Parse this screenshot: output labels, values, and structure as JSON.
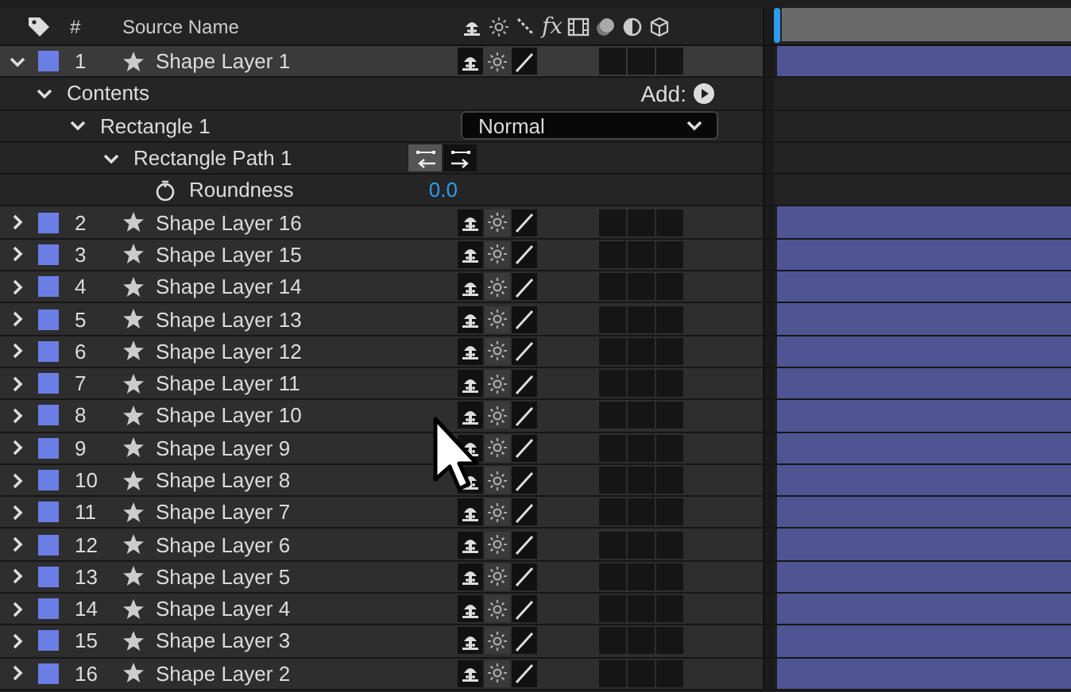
{
  "header": {
    "number_label": "#",
    "name_label": "Source Name",
    "effects_label": "fx"
  },
  "layers": [
    {
      "number": "1",
      "name": "Shape Layer 1",
      "color": "#6b7ee6",
      "expanded": true,
      "selected": true,
      "children": [
        {
          "kind": "group",
          "label": "Contents",
          "expanded": true,
          "add_label": "Add:",
          "children": [
            {
              "kind": "group",
              "label": "Rectangle 1",
              "expanded": true,
              "blend_mode": "Normal",
              "children": [
                {
                  "kind": "path",
                  "label": "Rectangle Path 1",
                  "expanded": true,
                  "directions": [
                    {
                      "selected": true
                    },
                    {
                      "selected": false
                    }
                  ],
                  "children": [
                    {
                      "kind": "property",
                      "label": "Roundness",
                      "value": "0.0"
                    }
                  ]
                }
              ]
            }
          ]
        }
      ]
    },
    {
      "number": "2",
      "name": "Shape Layer 16",
      "color": "#6b7ee6",
      "expanded": false,
      "selected": false
    },
    {
      "number": "3",
      "name": "Shape Layer 15",
      "color": "#6b7ee6",
      "expanded": false,
      "selected": false
    },
    {
      "number": "4",
      "name": "Shape Layer 14",
      "color": "#6b7ee6",
      "expanded": false,
      "selected": false
    },
    {
      "number": "5",
      "name": "Shape Layer 13",
      "color": "#6b7ee6",
      "expanded": false,
      "selected": false
    },
    {
      "number": "6",
      "name": "Shape Layer 12",
      "color": "#6b7ee6",
      "expanded": false,
      "selected": false
    },
    {
      "number": "7",
      "name": "Shape Layer 11",
      "color": "#6b7ee6",
      "expanded": false,
      "selected": false
    },
    {
      "number": "8",
      "name": "Shape Layer 10",
      "color": "#6b7ee6",
      "expanded": false,
      "selected": false
    },
    {
      "number": "9",
      "name": "Shape Layer 9",
      "color": "#6b7ee6",
      "expanded": false,
      "selected": false
    },
    {
      "number": "10",
      "name": "Shape Layer 8",
      "color": "#6b7ee6",
      "expanded": false,
      "selected": false
    },
    {
      "number": "11",
      "name": "Shape Layer 7",
      "color": "#6b7ee6",
      "expanded": false,
      "selected": false
    },
    {
      "number": "12",
      "name": "Shape Layer 6",
      "color": "#6b7ee6",
      "expanded": false,
      "selected": false
    },
    {
      "number": "13",
      "name": "Shape Layer 5",
      "color": "#6b7ee6",
      "expanded": false,
      "selected": false
    },
    {
      "number": "14",
      "name": "Shape Layer 4",
      "color": "#6b7ee6",
      "expanded": false,
      "selected": false
    },
    {
      "number": "15",
      "name": "Shape Layer 3",
      "color": "#6b7ee6",
      "expanded": false,
      "selected": false
    },
    {
      "number": "16",
      "name": "Shape Layer 2",
      "color": "#6b7ee6",
      "expanded": false,
      "selected": false
    }
  ]
}
